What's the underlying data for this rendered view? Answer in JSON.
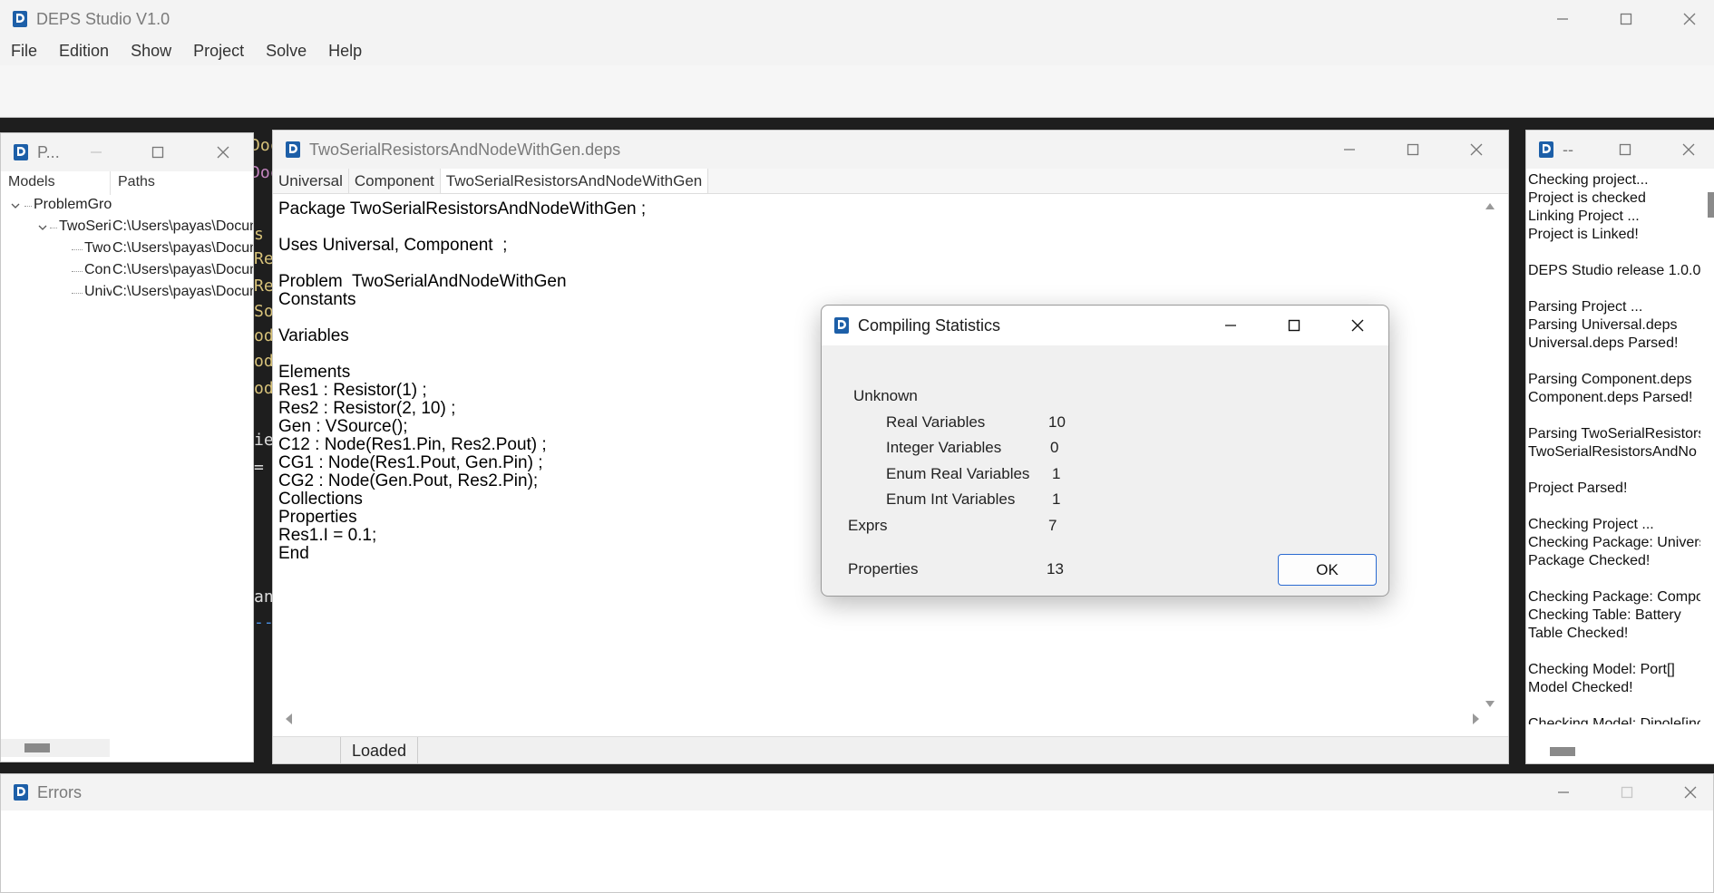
{
  "main": {
    "title": "DEPS Studio V1.0",
    "menu": [
      "File",
      "Edition",
      "Show",
      "Project",
      "Solve",
      "Help"
    ]
  },
  "left_panel": {
    "title": "P...",
    "tabs": [
      "Models",
      "Paths"
    ],
    "tree": [
      {
        "label": "ProblemGro",
        "path": ""
      },
      {
        "label": "TwoSeri",
        "path": "C:\\Users\\payas\\Docum"
      },
      {
        "label": "Two",
        "path": "C:\\Users\\payas\\Docum"
      },
      {
        "label": "Con",
        "path": "C:\\Users\\payas\\Docum"
      },
      {
        "label": "Univ",
        "path": "C:\\Users\\payas\\Docum"
      }
    ]
  },
  "editor": {
    "title": "TwoSerialResistorsAndNodeWithGen.deps",
    "tabs": [
      "Universal",
      "Component",
      "TwoSerialResistorsAndNodeWithGen"
    ],
    "code_lines": [
      "Package TwoSerialResistorsAndNodeWithGen ;",
      "",
      "Uses Universal, Component  ;",
      "",
      "Problem  TwoSerialAndNodeWithGen",
      "Constants",
      "",
      "Variables",
      "",
      "Elements",
      "Res1 : Resistor(1) ;",
      "Res2 : Resistor(2, 10) ;",
      "Gen : VSource();",
      "C12 : Node(Res1.Pin, Res2.Pout) ;",
      "CG1 : Node(Res1.Pout, Gen.Pin) ;",
      "CG2 : Node(Gen.Pout, Res2.Pin);",
      "Collections",
      "Properties",
      "Res1.I = 0.1;",
      "End"
    ],
    "status": "Loaded"
  },
  "log": {
    "title": "--",
    "lines": [
      "Checking project...",
      "Project is checked",
      "Linking Project ...",
      "Project is Linked!",
      "",
      "DEPS Studio release 1.0.0",
      "",
      "Parsing Project ...",
      "Parsing Universal.deps",
      "Universal.deps Parsed!",
      "",
      "Parsing Component.deps",
      "Component.deps Parsed!",
      "",
      "Parsing TwoSerialResistors",
      "TwoSerialResistorsAndNo",
      "",
      "Project Parsed!",
      "",
      "Checking Project ...",
      "Checking Package: Univers",
      "Package Checked!",
      "",
      "Checking Package: Compo",
      "Checking Table: Battery",
      "Table Checked!",
      "",
      "Checking Model: Port[]",
      "Model Checked!",
      "",
      "Checking Model: Dipole[inc",
      "Model Checked!"
    ]
  },
  "errors": {
    "title": "Errors"
  },
  "dialog": {
    "title": "Compiling Statistics",
    "unknown_label": "Unknown",
    "rows": [
      {
        "label": "Real Variables",
        "value": "10"
      },
      {
        "label": "Integer Variables",
        "value": "0"
      },
      {
        "label": "Enum Real Variables",
        "value": "1"
      },
      {
        "label": "Enum Int Variables",
        "value": "1"
      }
    ],
    "exprs_label": "Exprs",
    "exprs_value": "7",
    "properties_label": "Properties",
    "properties_value": "13",
    "ok_label": "OK"
  },
  "background_fragments": [
    "Doc",
    "Doc",
    "s",
    "Re",
    "Re",
    "So",
    "od",
    "od",
    "od",
    "ie",
    "=",
    "an",
    "--"
  ]
}
